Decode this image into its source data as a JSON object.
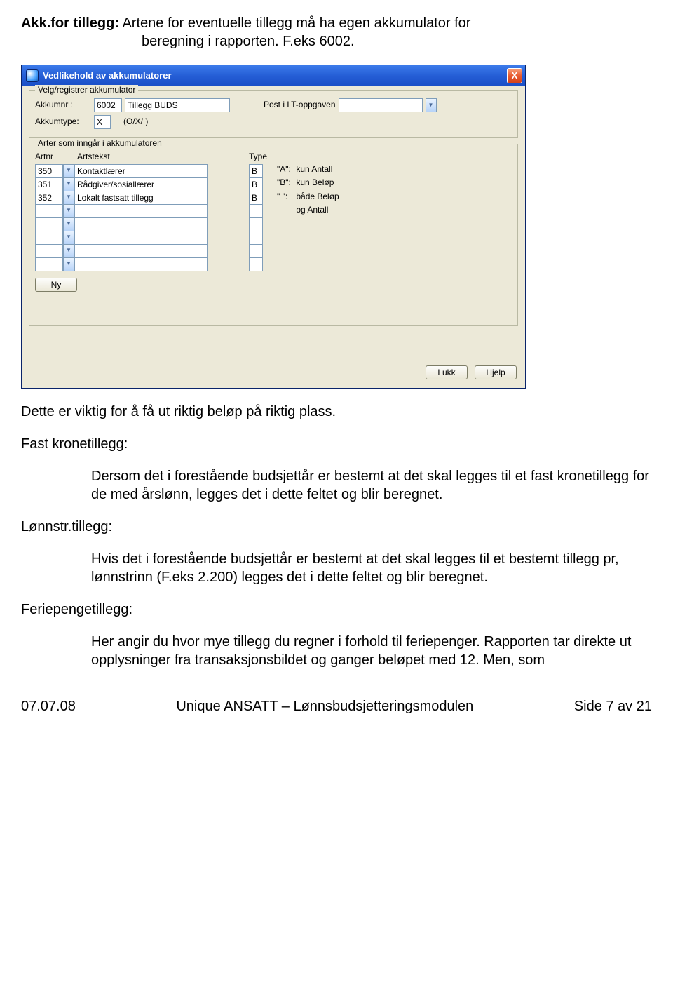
{
  "intro": {
    "label": "Akk.for tillegg:",
    "text_l1": "Artene for eventuelle tillegg må ha egen akkumulator for",
    "text_l2": "beregning i rapporten. F.eks 6002."
  },
  "dialog": {
    "title": "Vedlikehold av akkumulatorer",
    "close": "X",
    "group1": {
      "legend": "Velg/registrer akkumulator",
      "akkumnr_label": "Akkumnr :",
      "akkumnr_val": "6002",
      "akkum_name": "Tillegg BUDS",
      "post_label": "Post i LT-oppgaven",
      "post_val": "",
      "akkumtype_label": "Akkumtype:",
      "akkumtype_val": "X",
      "akkumtype_desc": "(O/X/ )"
    },
    "group2": {
      "legend": "Arter som inngår i akkumulatoren",
      "hdr_artnr": "Artnr",
      "hdr_tekst": "Artstekst",
      "hdr_type": "Type",
      "rows": [
        {
          "nr": "350",
          "tekst": "Kontaktlærer",
          "type": "B"
        },
        {
          "nr": "351",
          "tekst": "Rådgiver/sosiallærer",
          "type": "B"
        },
        {
          "nr": "352",
          "tekst": "Lokalt fastsatt tillegg",
          "type": "B"
        },
        {
          "nr": "",
          "tekst": "",
          "type": ""
        },
        {
          "nr": "",
          "tekst": "",
          "type": ""
        },
        {
          "nr": "",
          "tekst": "",
          "type": ""
        },
        {
          "nr": "",
          "tekst": "",
          "type": ""
        },
        {
          "nr": "",
          "tekst": "",
          "type": ""
        }
      ],
      "type_legend": [
        {
          "k": "\"A\":",
          "v": "kun Antall"
        },
        {
          "k": "\"B\":",
          "v": "kun Beløp"
        },
        {
          "k": "\" \":",
          "v": "både Beløp"
        },
        {
          "k": "",
          "v": "og Antall"
        }
      ],
      "ny": "Ny"
    },
    "lukk": "Lukk",
    "hjelp": "Hjelp"
  },
  "body": {
    "p1": "Dette er viktig for å få ut riktig beløp på riktig  plass.",
    "s1_label": "Fast kronetillegg:",
    "s1_text": "Dersom det i forestående budsjettår er bestemt at det skal legges til et fast kronetillegg for de med årslønn, legges det i dette feltet og blir beregnet.",
    "s2_label": "Lønnstr.tillegg:",
    "s2_text": "Hvis det i forestående budsjettår er bestemt at det skal legges til et bestemt tillegg pr, lønnstrinn (F.eks 2.200) legges det i dette feltet og blir beregnet.",
    "s3_label": "Feriepengetillegg:",
    "s3_text": "Her angir du hvor mye tillegg du regner i forhold til feriepenger. Rapporten tar direkte ut opplysninger fra transaksjonsbildet og ganger beløpet med 12. Men, som"
  },
  "footer": {
    "date": "07.07.08",
    "title": "Unique ANSATT – Lønnsbudsjetteringsmodulen",
    "page": "Side 7 av 21"
  }
}
